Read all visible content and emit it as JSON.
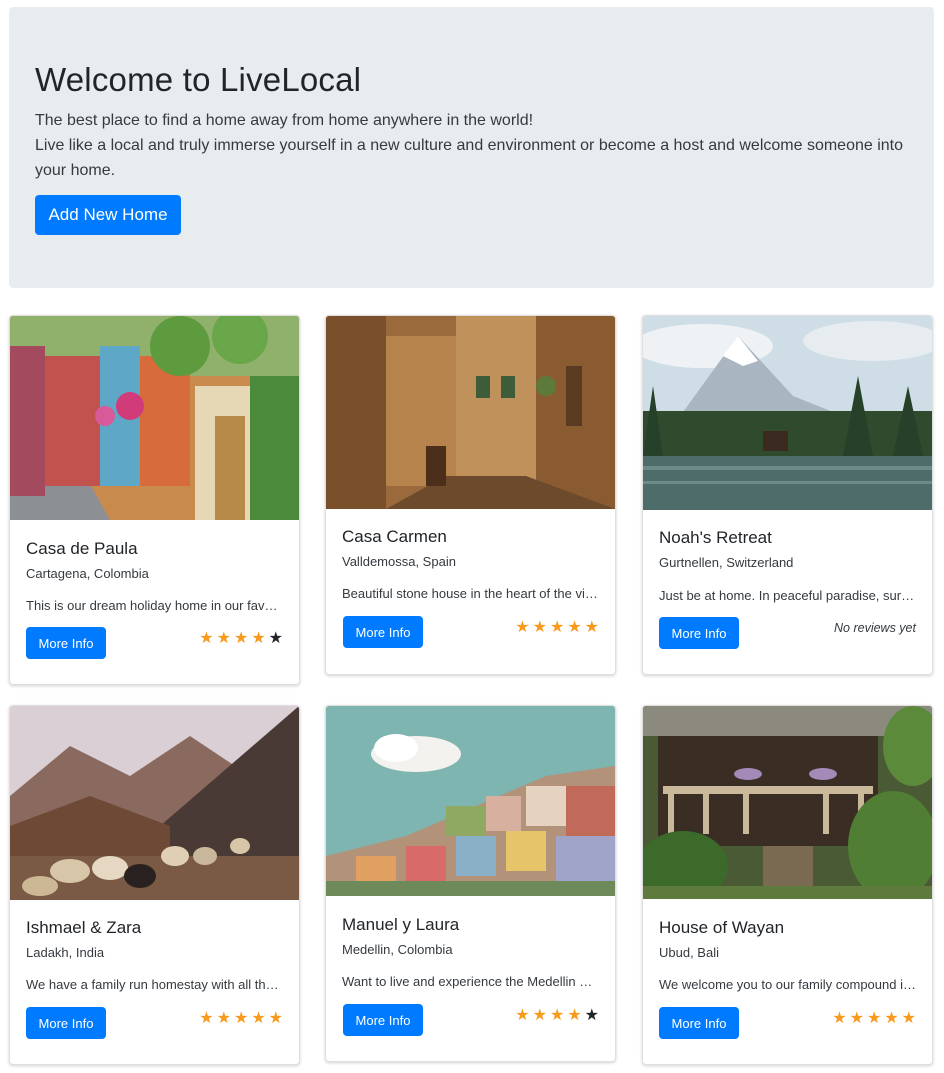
{
  "hero": {
    "title": "Welcome to LiveLocal",
    "lead_line1": "The best place to find a home away from home anywhere in the world!",
    "lead_line2": "Live like a local and truly immerse yourself in a new culture and environment or become a host and welcome someone into your home.",
    "add_button": "Add New Home"
  },
  "colors": {
    "accent": "#007bff",
    "star": "#f79a1d",
    "jumbotron": "#e9ecef"
  },
  "cards": [
    {
      "title": "Casa de Paula",
      "location": "Cartagena, Colombia",
      "description": "This is our dream holiday home in our favourite city",
      "button": "More Info",
      "rating": 4,
      "max_rating": 5,
      "image_icon": "colorful-street-photo"
    },
    {
      "title": "Casa Carmen",
      "location": "Valldemossa, Spain",
      "description": "Beautiful stone house in the heart of the village",
      "button": "More Info",
      "rating": 5,
      "max_rating": 5,
      "image_icon": "stone-alley-photo"
    },
    {
      "title": "Noah's Retreat",
      "location": "Gurtnellen, Switzerland",
      "description": "Just be at home. In peaceful paradise, surrounded by mountains",
      "button": "More Info",
      "rating": null,
      "no_reviews_text": "No reviews yet",
      "image_icon": "mountain-lake-photo"
    },
    {
      "title": "Ishmael & Zara",
      "location": "Ladakh, India",
      "description": "We have a family run homestay with all the comforts",
      "button": "More Info",
      "rating": 5,
      "max_rating": 5,
      "image_icon": "goats-valley-photo"
    },
    {
      "title": "Manuel y Laura",
      "location": "Medellin, Colombia",
      "description": "Want to live and experience the Medellin way of life",
      "button": "More Info",
      "rating": 4,
      "max_rating": 5,
      "image_icon": "hillside-houses-photo"
    },
    {
      "title": "House of Wayan",
      "location": "Ubud, Bali",
      "description": "We welcome you to our family compound in Ubud",
      "button": "More Info",
      "rating": 5,
      "max_rating": 5,
      "image_icon": "bali-house-photo"
    }
  ]
}
